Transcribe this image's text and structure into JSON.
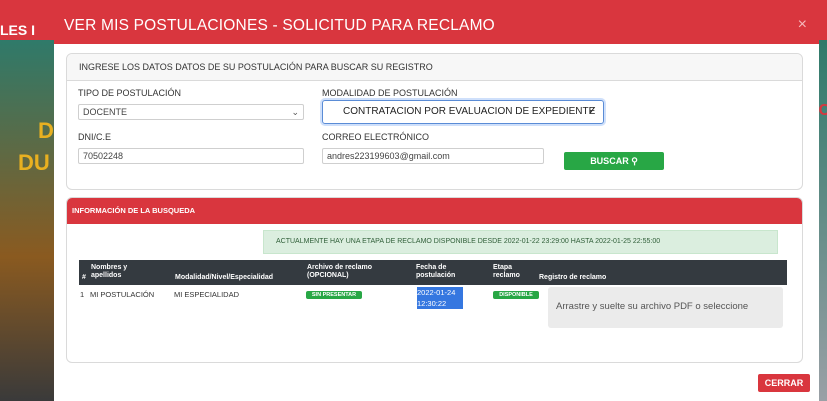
{
  "background": {
    "header_text": "LES I",
    "right_text": "IC",
    "left_letters": [
      "D",
      "DU"
    ]
  },
  "modal": {
    "title": "VER MIS POSTULACIONES - SOLICITUD PARA RECLAMO",
    "close_glyph": "×"
  },
  "search_card": {
    "header": "INGRESE LOS DATOS DATOS DE SU POSTULACIÓN PARA BUSCAR SU REGISTRO",
    "tipo_label": "TIPO DE POSTULACIÓN",
    "tipo_value": "DOCENTE",
    "modalidad_label": "MODALIDAD DE POSTULACIÓN",
    "modalidad_value": "CONTRATACION POR EVALUACION DE EXPEDIENTE",
    "dni_label": "DNI/C.E",
    "dni_value": "70502248",
    "correo_label": "CORREO ELECTRÓNICO",
    "correo_value": "andres223199603@gmail.com",
    "buscar_label": "BUSCAR"
  },
  "results_card": {
    "header": "INFORMACIÓN DE LA BUSQUEDA",
    "alert": "ACTUALMENTE HAY UNA ETAPA DE RECLAMO DISPONIBLE DESDE 2022-01-22 23:29:00 HASTA 2022-01-25 22:55:00",
    "columns": {
      "num": "#",
      "nombres": "Nombres y apellidos",
      "modalidad": "Modalidad/Nivel/Especialidad",
      "archivo": "Archivo de reclamo (OPCIONAL)",
      "fecha": "Fecha de postulación",
      "etapa": "Etapa reclamo",
      "registro": "Registro de reclamo"
    },
    "row": {
      "num": "1",
      "nombre": "MI POSTULACIÓN",
      "especialidad": "MI ESPECIALIDAD",
      "archivo_badge": "SIN PRESENTAR",
      "fecha_date": "2022-01-24",
      "fecha_time": "12:30:22",
      "etapa_badge": "DISPONIBLE",
      "dropzone": "Arrastre y suelte su archivo PDF o seleccione"
    }
  },
  "footer": {
    "cerrar_label": "CERRAR"
  },
  "colors": {
    "primary_red": "#d9363e",
    "success_green": "#28a745",
    "table_dark": "#343a40",
    "alert_green": "#dbeedf"
  }
}
